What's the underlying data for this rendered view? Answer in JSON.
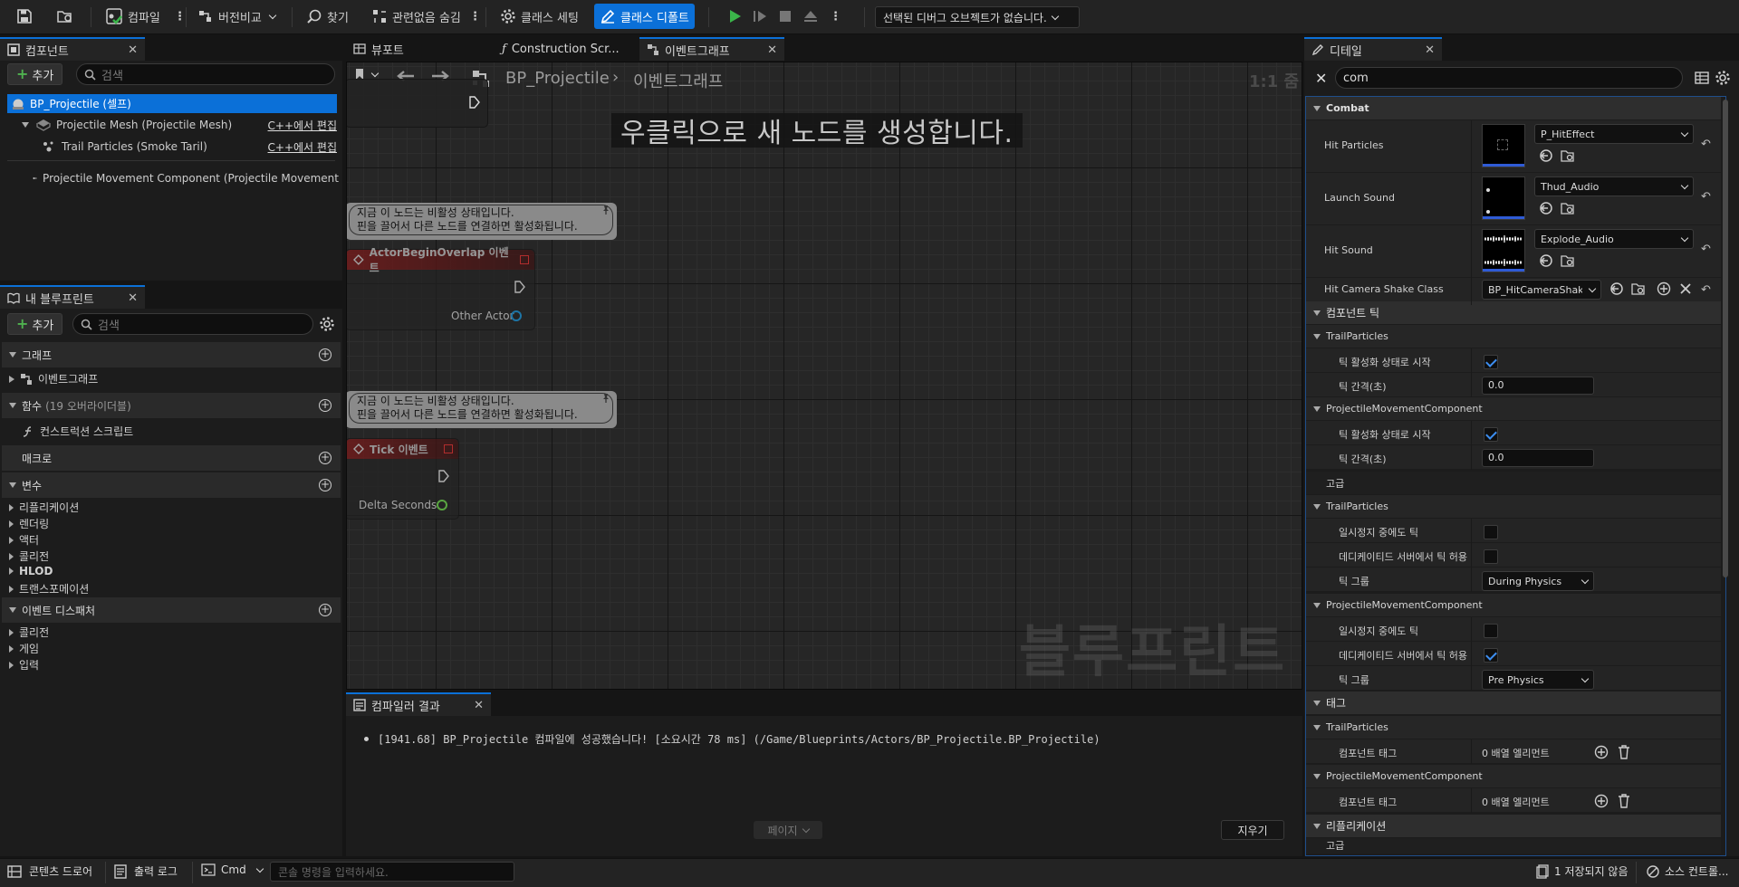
{
  "toolbar": {
    "compile": "컴파일",
    "diff": "버전비교",
    "find": "찾기",
    "hide_unrelated": "관련없음 숨김",
    "class_settings": "클래스 세팅",
    "class_defaults": "클래스 디폴트",
    "debug_object": "선택된 디버그 오브젝트가 없습니다."
  },
  "components": {
    "tab": "컴포넌트",
    "add": "추가",
    "search_placeholder": "검색",
    "items": [
      {
        "label": "BP_Projectile (셀프)"
      },
      {
        "label": "Projectile Mesh (Projectile Mesh)",
        "action": "C++에서 편집"
      },
      {
        "label": "Trail Particles (Smoke Taril)",
        "action": "C++에서 편집"
      },
      {
        "label": "Projectile Movement Component (Projectile Movement"
      }
    ]
  },
  "my_blueprint": {
    "tab": "내 블루프린트",
    "add": "추가",
    "search_placeholder": "검색",
    "graph_header": "그래프",
    "graph_item": "이벤트그래프",
    "functions_header": "함수",
    "functions_count": "(19 오버라이더블)",
    "function_item": "컨스트럭션 스크립트",
    "macros_header": "매크로",
    "variables_header": "변수",
    "variable_cats": [
      "리플리케이션",
      "렌더링",
      "액터",
      "콜리전",
      "HLOD",
      "트랜스포메이션"
    ],
    "dispatchers_header": "이벤트 디스패처",
    "dispatcher_cats": [
      "콜리전",
      "게임",
      "입력"
    ]
  },
  "editor_tabs": [
    {
      "label": "뷰포트"
    },
    {
      "label": "Construction Scr..."
    },
    {
      "label": "이벤트그래프"
    }
  ],
  "graph": {
    "breadcrumb_bp": "BP_Projectile",
    "breadcrumb_graph": "이벤트그래프",
    "zoom": "1:1 줌",
    "hint": "우클릭으로 새 노드를 생성합니다.",
    "watermark": "블루프린트",
    "comment_line1": "지금 이 노드는 비활성 상태입니다.",
    "comment_line2": "핀을 끌어서 다른 노드를 연결하면 활성화됩니다.",
    "node1_title": "ActorBeginOverlap 이벤트",
    "node1_pin": "Other Actor",
    "node2_title": "Tick 이벤트",
    "node2_pin": "Delta Seconds"
  },
  "compiler": {
    "tab": "컴파일러 결과",
    "message": "[1941.68] BP_Projectile 컴파일에 성공했습니다! [소요시간 78 ms] (/Game/Blueprints/Actors/BP_Projectile.BP_Projectile)",
    "page": "페이지",
    "clear": "지우기"
  },
  "details": {
    "tab": "디테일",
    "search_value": "com",
    "combat": "Combat",
    "hit_particles": "Hit Particles",
    "hit_particles_val": "P_HitEffect",
    "launch_sound": "Launch Sound",
    "launch_sound_val": "Thud_Audio",
    "hit_sound": "Hit Sound",
    "hit_sound_val": "Explode_Audio",
    "camshake": "Hit Camera Shake Class",
    "camshake_val": "BP_HitCameraShake",
    "comp_tick": "컴포넌트 틱",
    "trail": "TrailParticles",
    "pmc": "ProjectileMovementComponent",
    "tick_start": "틱 활성화 상태로 시작",
    "tick_interval": "틱 간격(초)",
    "tick_interval_val": "0.0",
    "advanced": "고급",
    "tick_paused": "일시정지 중에도 틱",
    "tick_dedicated": "데디케이티드 서버에서 틱 허용",
    "tick_group": "틱 그룹",
    "tick_group_trail": "During Physics",
    "tick_group_pmc": "Pre Physics",
    "tags": "태그",
    "comp_tags": "컴포넌트 태그",
    "array_elems": "0 배열 엘리먼트",
    "replication": "리플리케이션",
    "advanced2": "고급"
  },
  "statusbar": {
    "content_drawer": "콘텐츠 드로어",
    "output_log": "출력 로그",
    "cmd": "Cmd",
    "cmd_placeholder": "콘솔 명령을 입력하세요.",
    "unsaved": "1 저장되지 않음",
    "source_control": "소스 컨트롤..."
  }
}
